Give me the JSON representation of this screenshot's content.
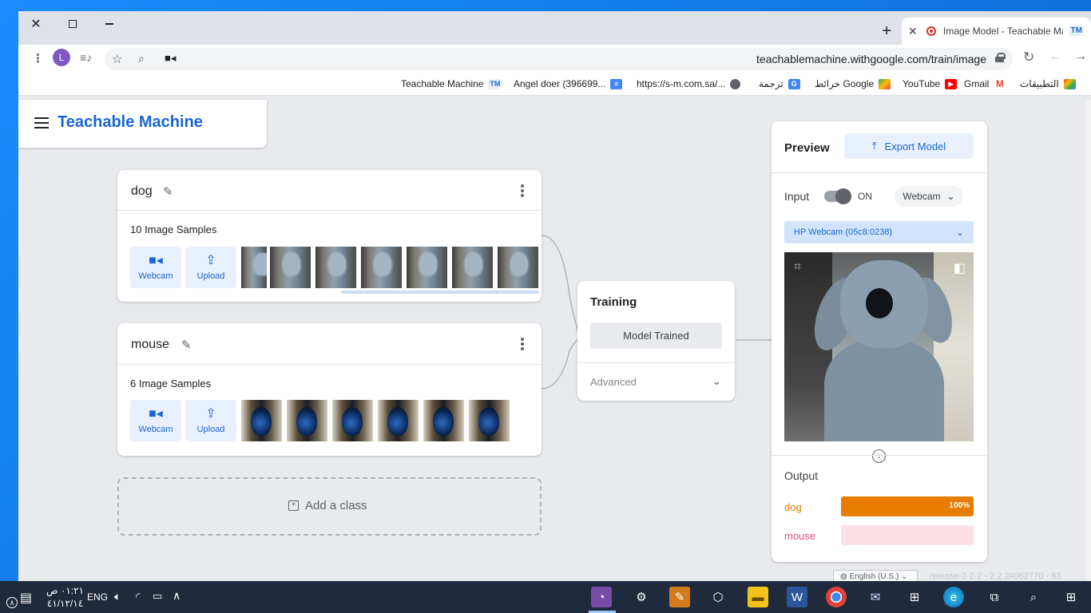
{
  "browser": {
    "tab_title": "Image Model - Teachable Ma",
    "tab_favicon": "TM",
    "url": "teachablemachine.withgoogle.com/train/image",
    "profile_initial": "L"
  },
  "bookmarks": [
    {
      "label": "التطبيقات",
      "icon": "apps-grid-icon"
    },
    {
      "label": "Gmail",
      "icon": "gmail-icon"
    },
    {
      "label": "YouTube",
      "icon": "youtube-icon"
    },
    {
      "label": "خرائط Google",
      "icon": "maps-icon"
    },
    {
      "label": "ترجمة",
      "icon": "translate-icon"
    },
    {
      "label": "https://s-m.com.sa/...",
      "icon": "globe-icon"
    },
    {
      "label": "Angel doer (396699...",
      "icon": "docs-icon"
    },
    {
      "label": "Teachable Machine",
      "icon": "tm-icon",
      "badge": "TM"
    }
  ],
  "app": {
    "logo": "Teachable Machine"
  },
  "classes": [
    {
      "name": "dog",
      "samples_label": "10 Image Samples",
      "webcam_label": "Webcam",
      "upload_label": "Upload"
    },
    {
      "name": "mouse",
      "samples_label": "6 Image Samples",
      "webcam_label": "Webcam",
      "upload_label": "Upload"
    }
  ],
  "add_class_label": "Add a class",
  "training": {
    "title": "Training",
    "button_label": "Model Trained",
    "advanced_label": "Advanced"
  },
  "preview": {
    "title": "Preview",
    "export_label": "Export Model",
    "input_label": "Input",
    "toggle_state": "ON",
    "source_select": "Webcam",
    "camera_select": "HP Webcam (05c8:0238)",
    "output_title": "Output",
    "outputs": [
      {
        "label": "dog",
        "value": 1.0,
        "percent_text": "100%",
        "color": "#e67c00",
        "track": "#fde4c8"
      },
      {
        "label": "mouse",
        "value": 0.0,
        "percent_text": "",
        "color": "#e24c78",
        "track": "#fde0e6"
      }
    ]
  },
  "footer": {
    "language": "English (U.S.)",
    "release": "release-2-2-2 - 2.2.2#062770 - 83"
  },
  "taskbar": {
    "time": "٠١:٢١ ص",
    "date": "٤١/١٢/١٤",
    "language": "ENG"
  }
}
